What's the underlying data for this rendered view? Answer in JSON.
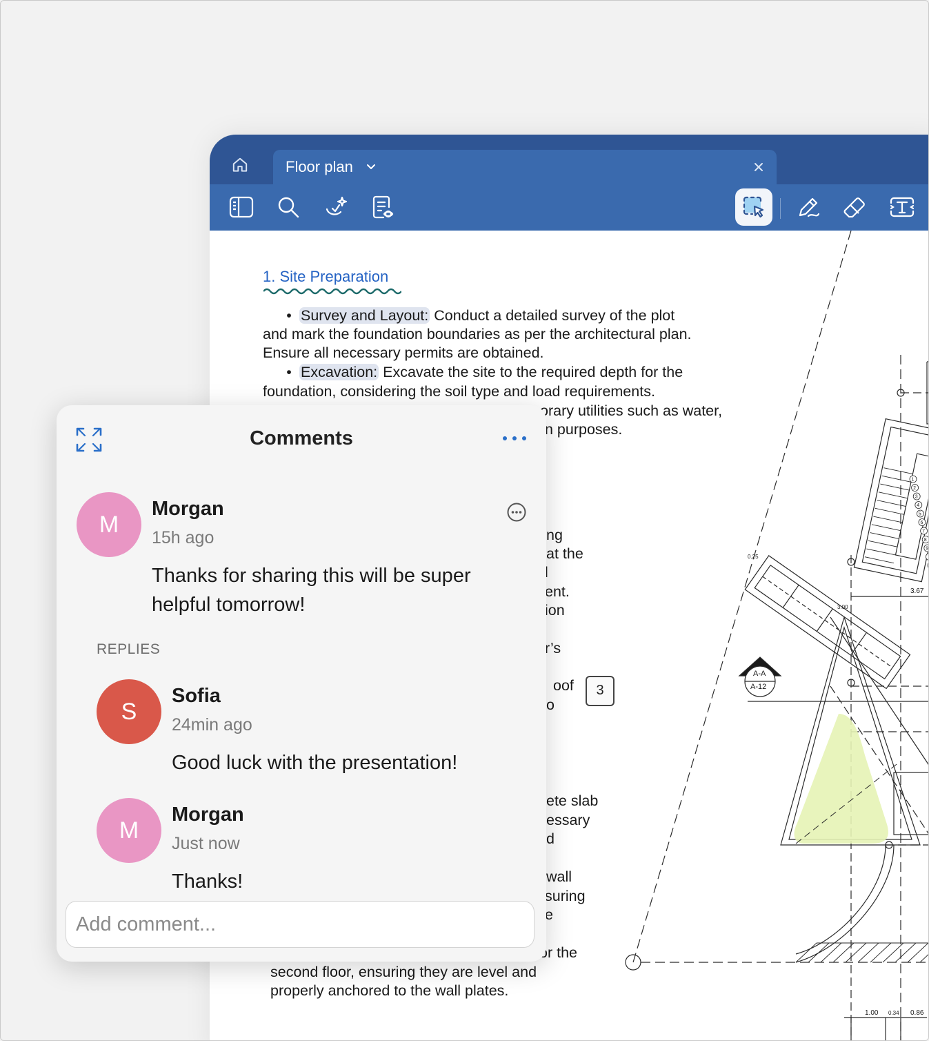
{
  "tab": {
    "title": "Floor plan"
  },
  "doc": {
    "heading": "1. Site Preparation",
    "lines": {
      "l1_hl": "Survey and Layout:",
      "l1": " Conduct a detailed survey of the plot",
      "l2": "and mark the foundation boundaries as per the architectural plan.",
      "l3": "Ensure all necessary permits are obtained.",
      "l4_hl": "Excavation:",
      "l4": " Excavate the site to the required depth for the",
      "l5": "foundation, considering the soil type and load requirements.",
      "l6": "orary utilities such as water,",
      "l7": "n purposes.",
      "f1": "ng",
      "f2": "at the",
      "f3": "l",
      "f4": "ent.",
      "f5": "ion",
      "f6": "r’s",
      "f7": "oof",
      "f8": "o",
      "f9": "ete slab",
      "f10": "essary",
      "f11": "d",
      "f12": "wall",
      "f13": "suring",
      "f14": "e",
      "f15": "or the",
      "b1": "second floor, ensuring they are level and",
      "b2": "properly anchored to the wall plates."
    },
    "badge": "3"
  },
  "plan": {
    "labels": {
      "aa": "A-A",
      "a12": "A-12",
      "d367": "3.67",
      "d025": "0.25",
      "d100": "1.00",
      "d034": "0.34",
      "d086": "0.86",
      "d300": "3.00"
    },
    "stairs": [
      "1",
      "2",
      "3",
      "4",
      "5",
      "6",
      "7",
      "8",
      "9",
      "10",
      "11",
      "12"
    ]
  },
  "comments": {
    "title": "Comments",
    "main": {
      "initial": "M",
      "name": "Morgan",
      "time": "15h ago",
      "body_line1": "Thanks for sharing this will be super",
      "body_line2": "helpful tomorrow!"
    },
    "replies_label": "REPLIES",
    "replies": [
      {
        "initial": "S",
        "name": "Sofia",
        "time": "24min ago",
        "body": "Good luck with the presentation!"
      },
      {
        "initial": "M",
        "name": "Morgan",
        "time": "Just now",
        "body": "Thanks!"
      }
    ],
    "input_placeholder": "Add comment..."
  },
  "colors": {
    "tabbar": "#2f5594",
    "toolbar": "#3a6aae",
    "heading": "#2563c4",
    "avatar_morgan": "#e996c4",
    "avatar_sofia": "#d9584a",
    "plan_highlight": "#e6f3b5"
  },
  "icons": {
    "home": "home-icon",
    "sidebar": "sidebar-icon",
    "search": "search-icon",
    "ai": "ai-sparkle-icon",
    "review": "document-review-icon",
    "select": "selection-tool-icon",
    "pen": "pen-icon",
    "eraser": "eraser-icon",
    "text": "text-box-icon"
  }
}
